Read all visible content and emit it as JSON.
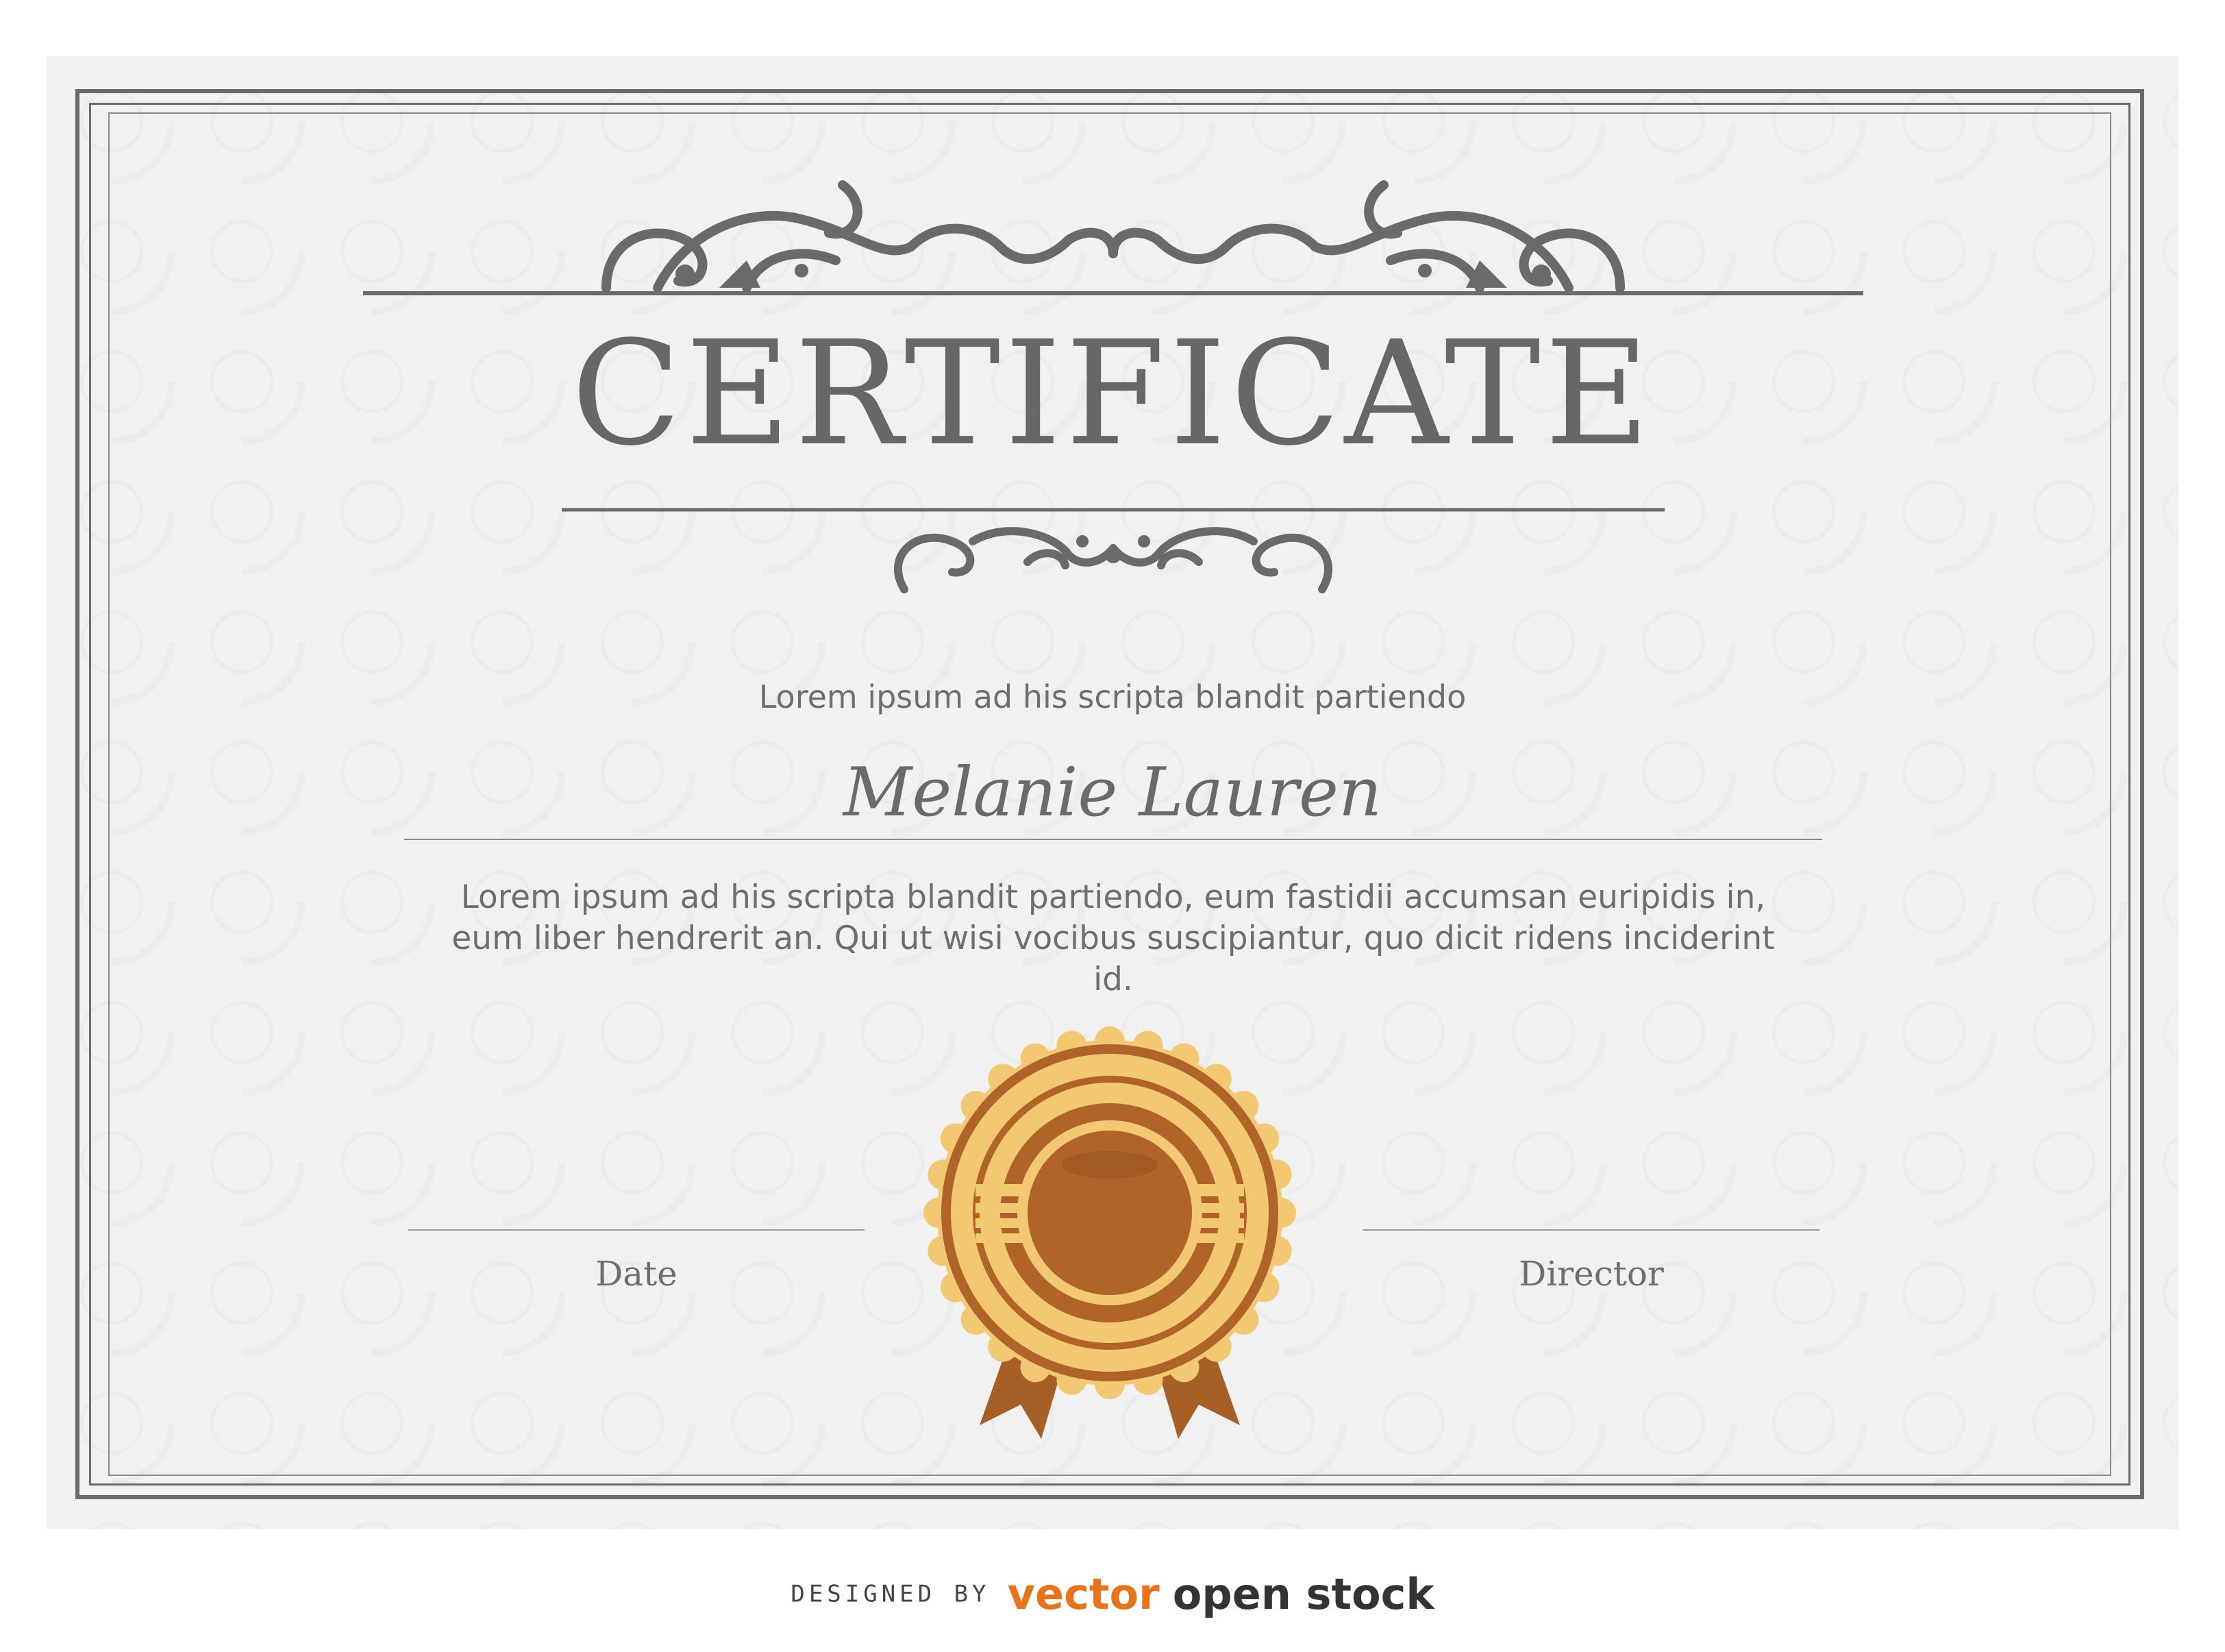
{
  "certificate": {
    "title": "CERTIFICATE",
    "subtitle": "Lorem ipsum ad his scripta blandit partiendo",
    "recipient_name": "Melanie Lauren",
    "body_text": "Lorem ipsum ad his scripta blandit partiendo, eum fastidii accumsan euripidis in, eum liber hendrerit an. Qui ut wisi vocibus suscipiantur, quo dicit ridens inciderint id.",
    "date_label": "Date",
    "director_label": "Director"
  },
  "footer": {
    "designed_by": "DESIGNED BY",
    "brand_vector": "vector",
    "brand_rest": "open stock"
  },
  "colors": {
    "frame": "#6a6a6a",
    "text": "#6e6e6e",
    "seal_gold": "#f3c872",
    "seal_brown": "#b0642a",
    "brand_orange": "#e8731a"
  },
  "icons": {
    "top_ornament": "flourish-top-icon",
    "bottom_ornament": "flourish-bottom-icon",
    "seal": "award-seal-icon"
  }
}
